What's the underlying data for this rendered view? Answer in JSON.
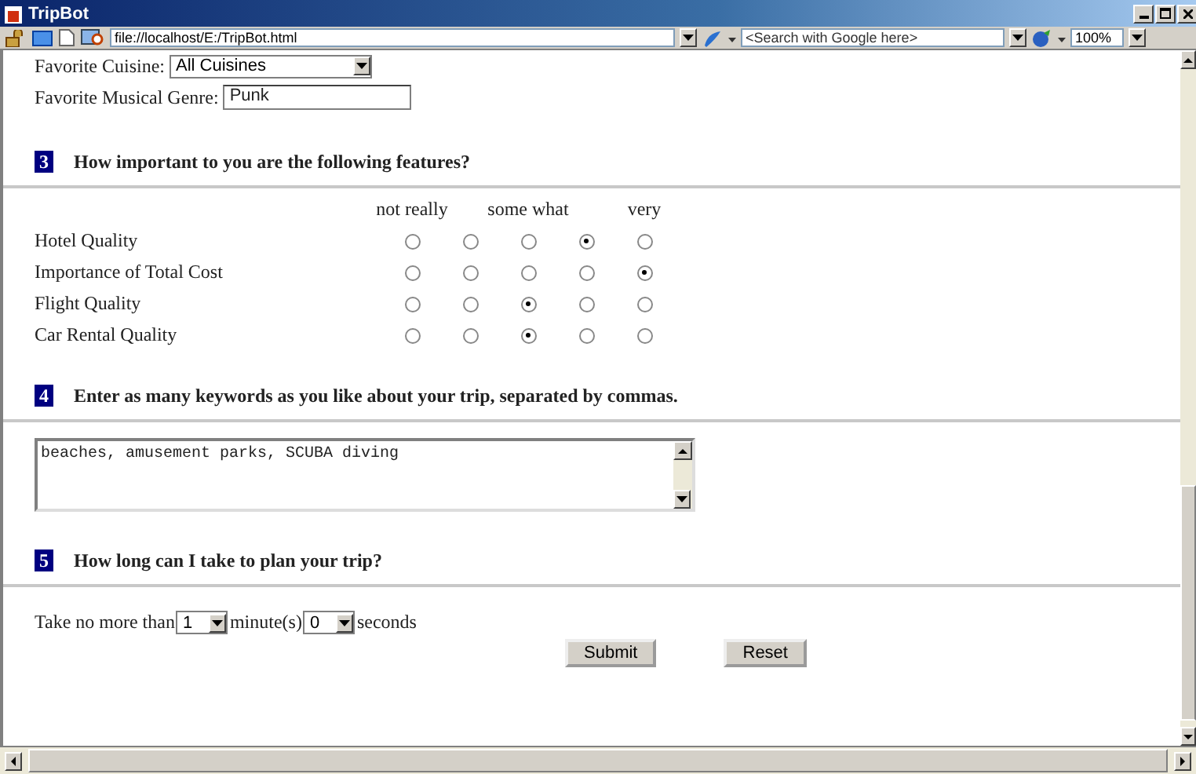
{
  "window": {
    "title": "TripBot"
  },
  "toolbar": {
    "address": "file://localhost/E:/TripBot.html",
    "search": {
      "placeholder": "<Search with Google here>"
    },
    "zoom": "100%"
  },
  "preferences": [
    {
      "label": "Favorite Cuisine:",
      "kind": "select",
      "value": "All Cuisines"
    },
    {
      "label": "Favorite Musical Genre:",
      "kind": "text",
      "value": "Punk"
    }
  ],
  "ratings_section": {
    "number": "3",
    "title": "How important to you are the following features?",
    "scale_labels": [
      "not really",
      "some what",
      "very"
    ],
    "items": [
      {
        "label": "Hotel Quality",
        "choices": [
          {
            "selected": false
          },
          {
            "selected": false
          },
          {
            "selected": false
          },
          {
            "selected": true
          },
          {
            "selected": false
          }
        ]
      },
      {
        "label": "Importance of Total Cost",
        "choices": [
          {
            "selected": false
          },
          {
            "selected": false
          },
          {
            "selected": false
          },
          {
            "selected": false
          },
          {
            "selected": true
          }
        ]
      },
      {
        "label": "Flight Quality",
        "choices": [
          {
            "selected": false
          },
          {
            "selected": false
          },
          {
            "selected": true
          },
          {
            "selected": false
          },
          {
            "selected": false
          }
        ]
      },
      {
        "label": "Car Rental Quality",
        "choices": [
          {
            "selected": false
          },
          {
            "selected": false
          },
          {
            "selected": true
          },
          {
            "selected": false
          },
          {
            "selected": false
          }
        ]
      }
    ]
  },
  "keywords_section": {
    "number": "4",
    "title": "Enter as many keywords as you like about your trip, separated by commas.",
    "value": "beaches, amusement parks, SCUBA diving"
  },
  "time_section": {
    "number": "5",
    "title": "How long can I take to plan your trip?",
    "prefix": "Take no more than",
    "minutes": "1",
    "minutes_unit": "minute(s)",
    "seconds": "0",
    "seconds_unit": "seconds"
  },
  "buttons": [
    "Submit",
    "Reset"
  ]
}
